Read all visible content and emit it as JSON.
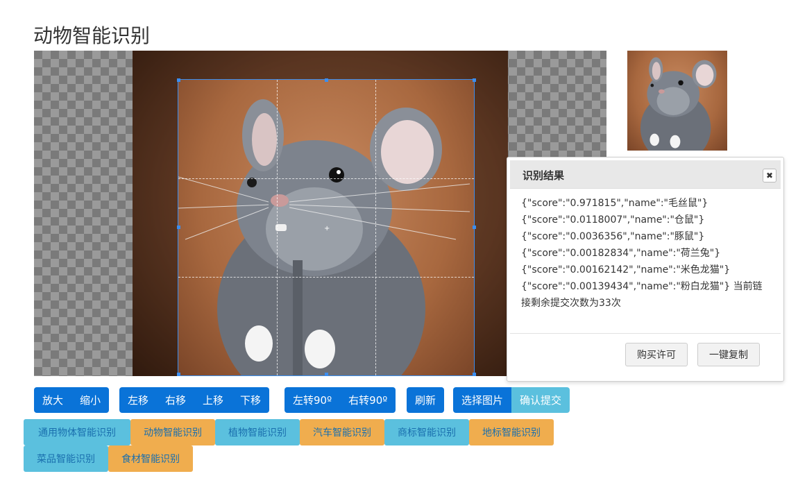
{
  "page": {
    "title": "动物智能识别"
  },
  "cropper": {
    "image_subject": "chinchilla"
  },
  "result_dialog": {
    "title": "识别结果",
    "close_icon": "close-icon",
    "lines": [
      "{\"score\":\"0.971815\",\"name\":\"毛丝鼠\"}",
      "{\"score\":\"0.0118007\",\"name\":\"仓鼠\"}",
      "{\"score\":\"0.0036356\",\"name\":\"豚鼠\"}",
      "{\"score\":\"0.00182834\",\"name\":\"荷兰兔\"}",
      "{\"score\":\"0.00162142\",\"name\":\"米色龙猫\"}",
      "{\"score\":\"0.00139434\",\"name\":\"粉白龙猫\"} 当前链",
      "接剩余提交次数为33次"
    ],
    "buy_label": "购买许可",
    "copy_label": "一键复制"
  },
  "toolbar": {
    "zoom_in": "放大",
    "zoom_out": "缩小",
    "move_left": "左移",
    "move_right": "右移",
    "move_up": "上移",
    "move_down": "下移",
    "rotate_left": "左转90º",
    "rotate_right": "右转90º",
    "refresh": "刷新",
    "choose_image": "选择图片",
    "confirm_submit": "确认提交"
  },
  "recognition_types": [
    {
      "label": "通用物体智能识别",
      "color": "#5bc0de"
    },
    {
      "label": "动物智能识别",
      "color": "#f0ad4e"
    },
    {
      "label": "植物智能识别",
      "color": "#5bc0de"
    },
    {
      "label": "汽车智能识别",
      "color": "#f0ad4e"
    },
    {
      "label": "商标智能识别",
      "color": "#5bc0de"
    },
    {
      "label": "地标智能识别",
      "color": "#f0ad4e"
    },
    {
      "label": "菜品智能识别",
      "color": "#5bc0de"
    },
    {
      "label": "食材智能识别",
      "color": "#f0ad4e"
    }
  ],
  "colors": {
    "primary": "#0a73d8",
    "info": "#5bc0de",
    "warning": "#f0ad4e",
    "crop_outline": "#3b8ef0"
  }
}
